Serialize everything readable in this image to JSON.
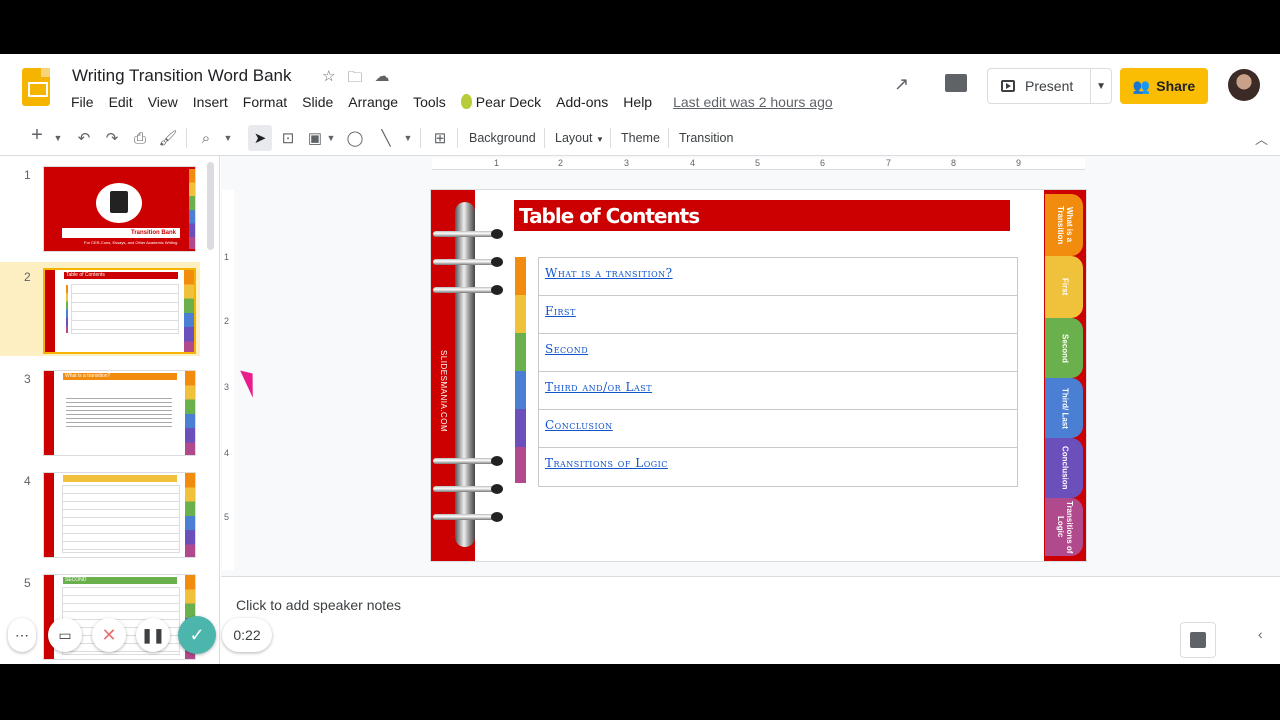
{
  "header": {
    "doc_title": "Writing Transition Word Bank",
    "menus": [
      "File",
      "Edit",
      "View",
      "Insert",
      "Format",
      "Slide",
      "Arrange",
      "Tools"
    ],
    "addon_menu": "Pear Deck",
    "menus_after": [
      "Add-ons",
      "Help"
    ],
    "last_edit": "Last edit was 2 hours ago",
    "present_label": "Present",
    "share_label": "Share",
    "brand_color": "#fbbc04"
  },
  "toolbar": {
    "background_label": "Background",
    "layout_label": "Layout",
    "theme_label": "Theme",
    "transition_label": "Transition"
  },
  "filmstrip": {
    "slides": [
      {
        "number": "1",
        "title": "Transition Bank",
        "subtitle": "For CER-Cons, Essays, and Other Academic Writing"
      },
      {
        "number": "2",
        "title": "Table of Contents"
      },
      {
        "number": "3",
        "title": "What is a transition?"
      },
      {
        "number": "4",
        "title": ""
      },
      {
        "number": "5",
        "title": "SECOND"
      }
    ],
    "active_index": 1
  },
  "ruler": {
    "h_ticks": [
      "1",
      "2",
      "3",
      "4",
      "5",
      "6",
      "7",
      "8",
      "9"
    ],
    "v_ticks": [
      "1",
      "2",
      "3",
      "4",
      "5"
    ]
  },
  "slide": {
    "title": "Table of Contents",
    "binder_text": "SLIDESMANIA.COM",
    "toc": [
      "What is a transition?",
      "First",
      "Second",
      "Third and/or Last",
      "Conclusion",
      "Transitions of Logic"
    ],
    "strip_colors": [
      "#f28c0f",
      "#f0c23b",
      "#6ab04c",
      "#4a7fd4",
      "#6b4fbb",
      "#b04a8c"
    ],
    "tabs": [
      {
        "label": "What is a Transition",
        "color": "#f28c0f"
      },
      {
        "label": "First",
        "color": "#f0c23b"
      },
      {
        "label": "Second",
        "color": "#6ab04c"
      },
      {
        "label": "Third/ Last",
        "color": "#4a7fd4"
      },
      {
        "label": "Conclusion",
        "color": "#6b4fbb"
      },
      {
        "label": "Transitions of Logic",
        "color": "#b04a8c"
      }
    ]
  },
  "notes": {
    "placeholder": "Click to add speaker notes"
  },
  "recorder": {
    "elapsed": "0:22"
  }
}
